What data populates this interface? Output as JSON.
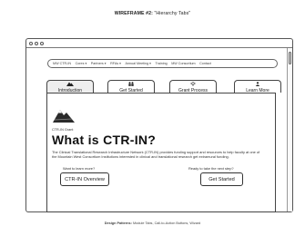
{
  "wireframe": {
    "title": "WIREFRAME #2:",
    "subtitle": "\"Hierarchy Tabs\""
  },
  "nav": {
    "items": [
      "MW CTR-IN",
      "Cores ▾",
      "Partners ▾",
      "RFAs ▾",
      "Annual Meeting ▾",
      "Training",
      "MW Consortium",
      "Contact"
    ]
  },
  "tabs": [
    {
      "label": "Introduction",
      "icon": "mountain-icon",
      "active": true
    },
    {
      "label": "Get Started",
      "icon": "people-icon",
      "active": false
    },
    {
      "label": "Grant Process",
      "icon": "lightbulb-icon",
      "active": false
    },
    {
      "label": "Learn More",
      "icon": "user-icon",
      "active": false
    }
  ],
  "content": {
    "eyebrow": "CTR-IN Grant",
    "headline": "What is CTR-IN?",
    "description": "The Clinical Translational Research Infrastructure Network (CTR-IN) provides funding support and resources to help faculty at one of the Mountain West Consortium Institutions interested in clinical and translational research get extramural funding.",
    "left_prompt": "Want to learn more?",
    "left_button": "CTR-IN Overview",
    "right_prompt": "Ready to take the next step?",
    "right_button": "Get Started"
  },
  "footer": {
    "label": "Design Patterns:",
    "text": "Module Tabs, Call-to-Action Buttons, Wizard"
  }
}
